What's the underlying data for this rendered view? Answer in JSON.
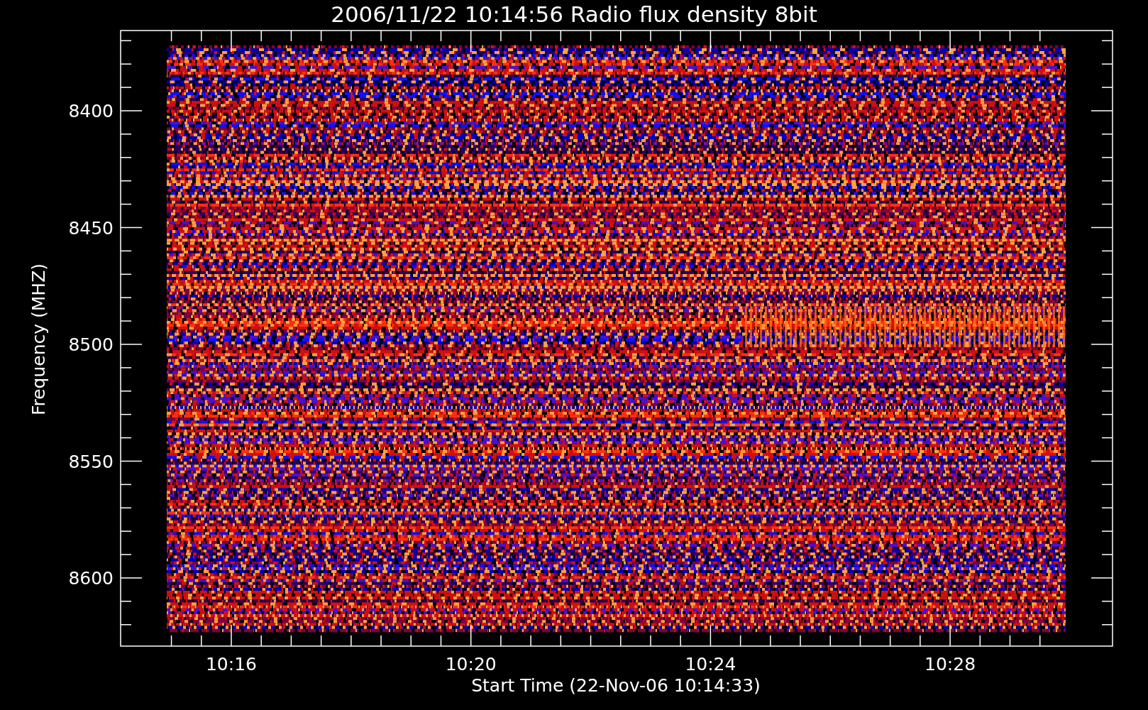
{
  "title": "2006/11/22 10:14:56 Radio flux density 8bit",
  "y_axis": {
    "label": "Frequency (MHZ)",
    "ticks": [
      "8400",
      "8450",
      "8500",
      "8550",
      "8600"
    ]
  },
  "x_axis": {
    "label": "Start Time (22-Nov-06 10:14:33)",
    "ticks": [
      "10:16",
      "10:20",
      "10:24",
      "10:28"
    ]
  }
}
